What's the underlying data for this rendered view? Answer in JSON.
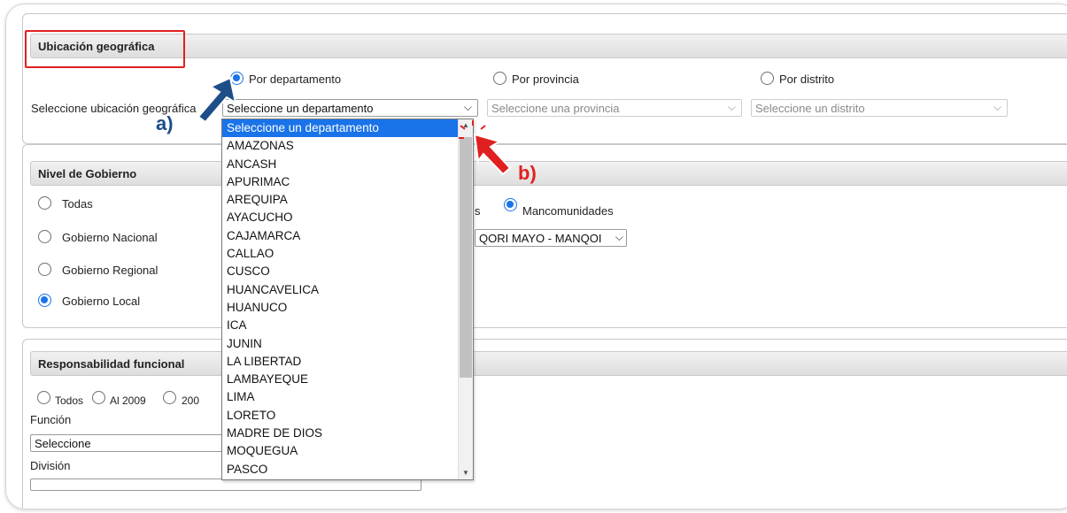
{
  "ubicacion": {
    "header": "Ubicación geográfica",
    "radio_departamento": "Por departamento",
    "radio_provincia": "Por provincia",
    "radio_distrito": "Por distrito",
    "select_label": "Seleccione ubicación geográfica",
    "select_departamento": "Seleccione un departamento",
    "select_provincia": "Seleccione una provincia",
    "select_distrito": "Seleccione un distrito"
  },
  "nivel": {
    "header": "Nivel de Gobierno",
    "todas": "Todas",
    "nacional": "Gobierno Nacional",
    "regional": "Gobierno Regional",
    "local": "Gobierno Local",
    "partial_label": "s",
    "mancomunidades": "Mancomunidades",
    "mancomunidad_select": "QORI MAYO - MANQOI"
  },
  "responsabilidad": {
    "header": "Responsabilidad funcional",
    "todos": "Todos",
    "al_2009": "Al 2009",
    "partial_2009": "200",
    "funcion_label": "Función",
    "funcion_select": "Seleccione",
    "division_label": "División"
  },
  "dropdown": {
    "items": [
      "Seleccione un departamento",
      "AMAZONAS",
      "ANCASH",
      "APURIMAC",
      "AREQUIPA",
      "AYACUCHO",
      "CAJAMARCA",
      "CALLAO",
      "CUSCO",
      "HUANCAVELICA",
      "HUANUCO",
      "ICA",
      "JUNIN",
      "LA LIBERTAD",
      "LAMBAYEQUE",
      "LIMA",
      "LORETO",
      "MADRE DE DIOS",
      "MOQUEGUA",
      "PASCO"
    ],
    "selected_index": 0
  },
  "annotations": {
    "label_a": "a)",
    "label_b": "b)",
    "color_a": "#1d4e89",
    "color_b": "#e02020"
  },
  "colors": {
    "accent": "#1a73e8",
    "highlight_box": "#e02020"
  },
  "icons": {
    "select_arrow": "chevron-down-icon",
    "arrow_a": "arrow-pointer-icon",
    "arrow_b": "arrow-pointer-icon"
  }
}
